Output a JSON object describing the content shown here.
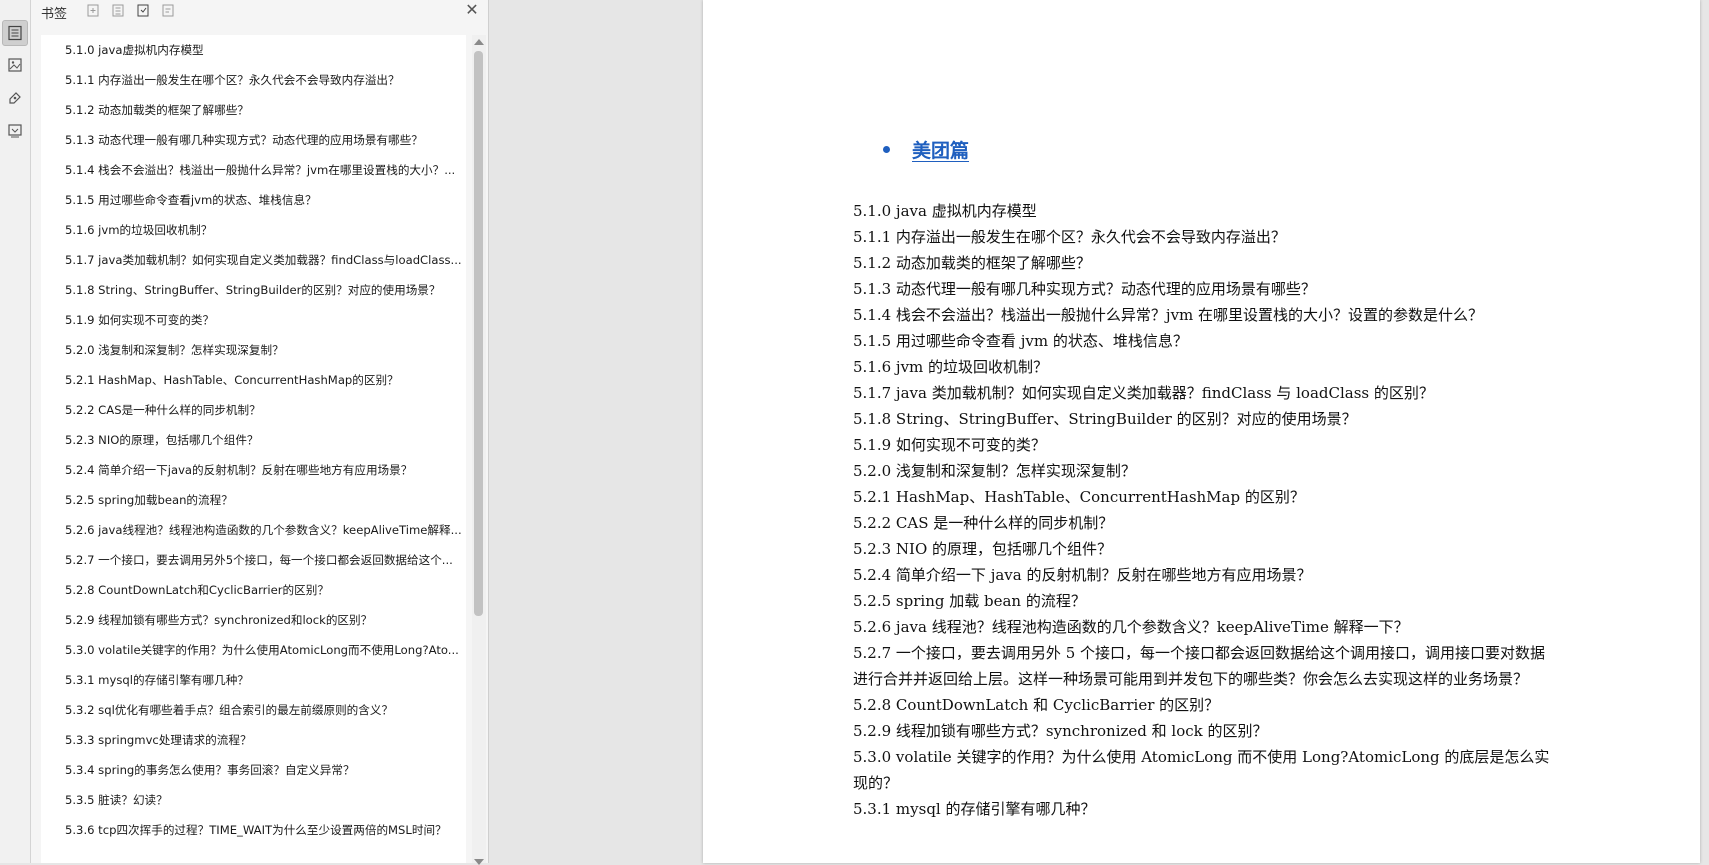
{
  "panel": {
    "title": "书签",
    "header_icons": [
      "add-bookmark-icon",
      "expand-all-icon",
      "collapse-all-icon",
      "bookmark-options-icon"
    ]
  },
  "left_toolbar": {
    "icons": [
      "bookmarks-panel-icon",
      "thumbnails-panel-icon",
      "annotations-panel-icon",
      "attachments-panel-icon"
    ]
  },
  "bookmarks": [
    "5.1.0 java虚拟机内存模型",
    "5.1.1 内存溢出一般发生在哪个区？永久代会不会导致内存溢出？",
    "5.1.2 动态加载类的框架了解哪些？",
    "5.1.3 动态代理一般有哪几种实现方式？动态代理的应用场景有哪些？",
    "5.1.4 栈会不会溢出？栈溢出一般抛什么异常？jvm在哪里设置栈的大小？...",
    "5.1.5 用过哪些命令查看jvm的状态、堆栈信息？",
    "5.1.6 jvm的垃圾回收机制？",
    "5.1.7 java类加载机制？如何实现自定义类加载器？findClass与loadClass...",
    "5.1.8 String、StringBuffer、StringBuilder的区别？对应的使用场景？",
    "5.1.9 如何实现不可变的类？",
    "5.2.0 浅复制和深复制？怎样实现深复制？",
    "5.2.1 HashMap、HashTable、ConcurrentHashMap的区别？",
    "5.2.2 CAS是一种什么样的同步机制？",
    "5.2.3 NIO的原理，包括哪几个组件？",
    "5.2.4 简单介绍一下java的反射机制？反射在哪些地方有应用场景？",
    "5.2.5 spring加载bean的流程？",
    "5.2.6 java线程池？线程池构造函数的几个参数含义？keepAliveTime解释...",
    "5.2.7 一个接口，要去调用另外5个接口，每一个接口都会返回数据给这个...",
    "5.2.8 CountDownLatch和CyclicBarrier的区别？",
    "5.2.9 线程加锁有哪些方式？synchronized和lock的区别？",
    "5.3.0 volatile关键字的作用？为什么使用AtomicLong而不使用Long?Ato...",
    "5.3.1 mysql的存储引擎有哪几种？",
    "5.3.2 sql优化有哪些着手点？组合索引的最左前缀原则的含义？",
    "5.3.3 springmvc处理请求的流程？",
    "5.3.4 spring的事务怎么使用？事务回滚？自定义异常？",
    "5.3.5 脏读？幻读？",
    "5.3.6 tcp四次挥手的过程？TIME_WAIT为什么至少设置两倍的MSL时间？"
  ],
  "document": {
    "heading": "美团篇",
    "toc_lines": [
      "5.1.0 java 虚拟机内存模型",
      "5.1.1  内存溢出一般发生在哪个区？永久代会不会导致内存溢出？",
      "5.1.2  动态加载类的框架了解哪些？",
      "5.1.3  动态代理一般有哪几种实现方式？动态代理的应用场景有哪些？",
      "5.1.4  栈会不会溢出？栈溢出一般抛什么异常？jvm 在哪里设置栈的大小？设置的参数是什么？",
      "5.1.5  用过哪些命令查看 jvm 的状态、堆栈信息？",
      "5.1.6 jvm 的垃圾回收机制？",
      "5.1.7 java 类加载机制？如何实现自定义类加载器？findClass 与 loadClass 的区别？",
      "5.1.8 String、StringBuffer、StringBuilder 的区别？对应的使用场景？",
      "5.1.9  如何实现不可变的类？",
      "5.2.0  浅复制和深复制？怎样实现深复制？",
      "5.2.1 HashMap、HashTable、ConcurrentHashMap 的区别？",
      "5.2.2 CAS 是一种什么样的同步机制？",
      "5.2.3 NIO 的原理，包括哪几个组件？",
      "5.2.4  简单介绍一下 java 的反射机制？反射在哪些地方有应用场景？",
      "5.2.5 spring 加载 bean 的流程？",
      "5.2.6 java 线程池？线程池构造函数的几个参数含义？keepAliveTime 解释一下？",
      "5.2.7  一个接口，要去调用另外 5 个接口，每一个接口都会返回数据给这个调用接口，调用接口要对数据进行合并并返回给上层。这样一种场景可能用到并发包下的哪些类？你会怎么去实现这样的业务场景？",
      "5.2.8 CountDownLatch 和 CyclicBarrier 的区别？",
      "5.2.9  线程加锁有哪些方式？synchronized 和 lock 的区别？",
      "5.3.0 volatile 关键字的作用？为什么使用 AtomicLong 而不使用 Long?AtomicLong 的底层是怎么实现的？",
      "5.3.1 mysql 的存储引擎有哪几种？"
    ]
  },
  "colors": {
    "heading_blue": "#1f5fbf",
    "panel_bg": "#f5f5f5",
    "workspace_bg": "#e6e6e6"
  }
}
